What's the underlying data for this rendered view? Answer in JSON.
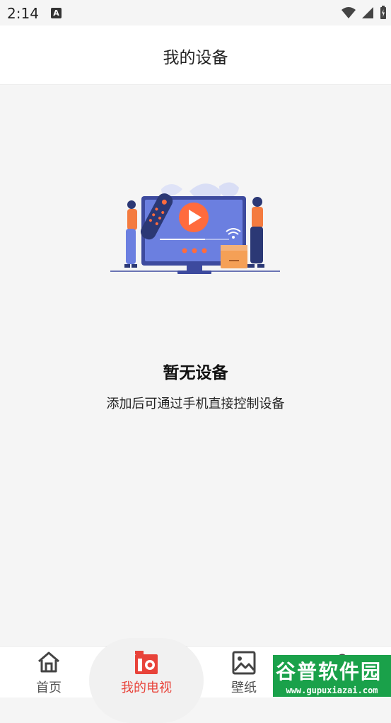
{
  "status_bar": {
    "time": "2:14",
    "notification_letter": "A"
  },
  "header": {
    "title": "我的设备"
  },
  "empty_state": {
    "title": "暂无设备",
    "subtitle": "添加后可通过手机直接控制设备"
  },
  "nav": {
    "items": [
      {
        "label": "首页",
        "icon": "home-icon",
        "active": false
      },
      {
        "label": "我的电视",
        "icon": "tv-icon",
        "active": true
      },
      {
        "label": "壁纸",
        "icon": "image-icon",
        "active": false
      }
    ]
  },
  "watermark": {
    "top": "谷普软件园",
    "bottom": "www.gupuxiazai.com"
  },
  "colors": {
    "accent": "#e8433a",
    "orange": "#f47b3f",
    "tv_blue": "#5a6fd8",
    "watermark_green": "#1aa14a"
  }
}
